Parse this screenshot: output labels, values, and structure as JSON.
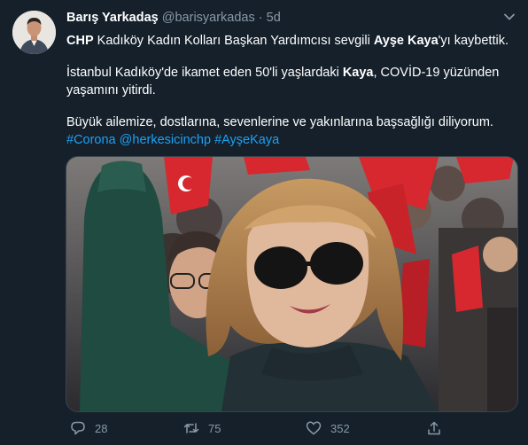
{
  "author": {
    "name": "Barış Yarkadaş",
    "handle": "@barisyarkadas",
    "separator": "·",
    "time": "5d"
  },
  "tweet": {
    "p1_b1": "CHP",
    "p1_t1": " Kadıköy Kadın Kolları Başkan Yardımcısı sevgili ",
    "p1_b2": "Ayşe Kaya",
    "p1_t2": "'yı kaybettik.",
    "p2_t1": "İstanbul Kadıköy'de ikamet eden 50'li yaşlardaki ",
    "p2_b1": "Kaya",
    "p2_t2": ", COVİD-19 yüzünden yaşamını yitirdi.",
    "p3": "Büyük ailemize, dostlarına, sevenlerine ve yakınlarına başsağlığı diliyorum.",
    "hashtags": [
      "#Corona",
      "@herkesicinchp",
      "#AyşeKaya"
    ]
  },
  "stats": {
    "replies": "28",
    "retweets": "75",
    "likes": "352"
  },
  "icons": {
    "more": "chevron-down-icon",
    "reply": "reply-icon",
    "retweet": "retweet-icon",
    "like": "heart-icon",
    "share": "share-icon"
  },
  "colors": {
    "background": "#15202b",
    "text": "#ffffff",
    "muted": "#8899a6",
    "link": "#1da1f2",
    "flag_red": "#d7282f"
  }
}
